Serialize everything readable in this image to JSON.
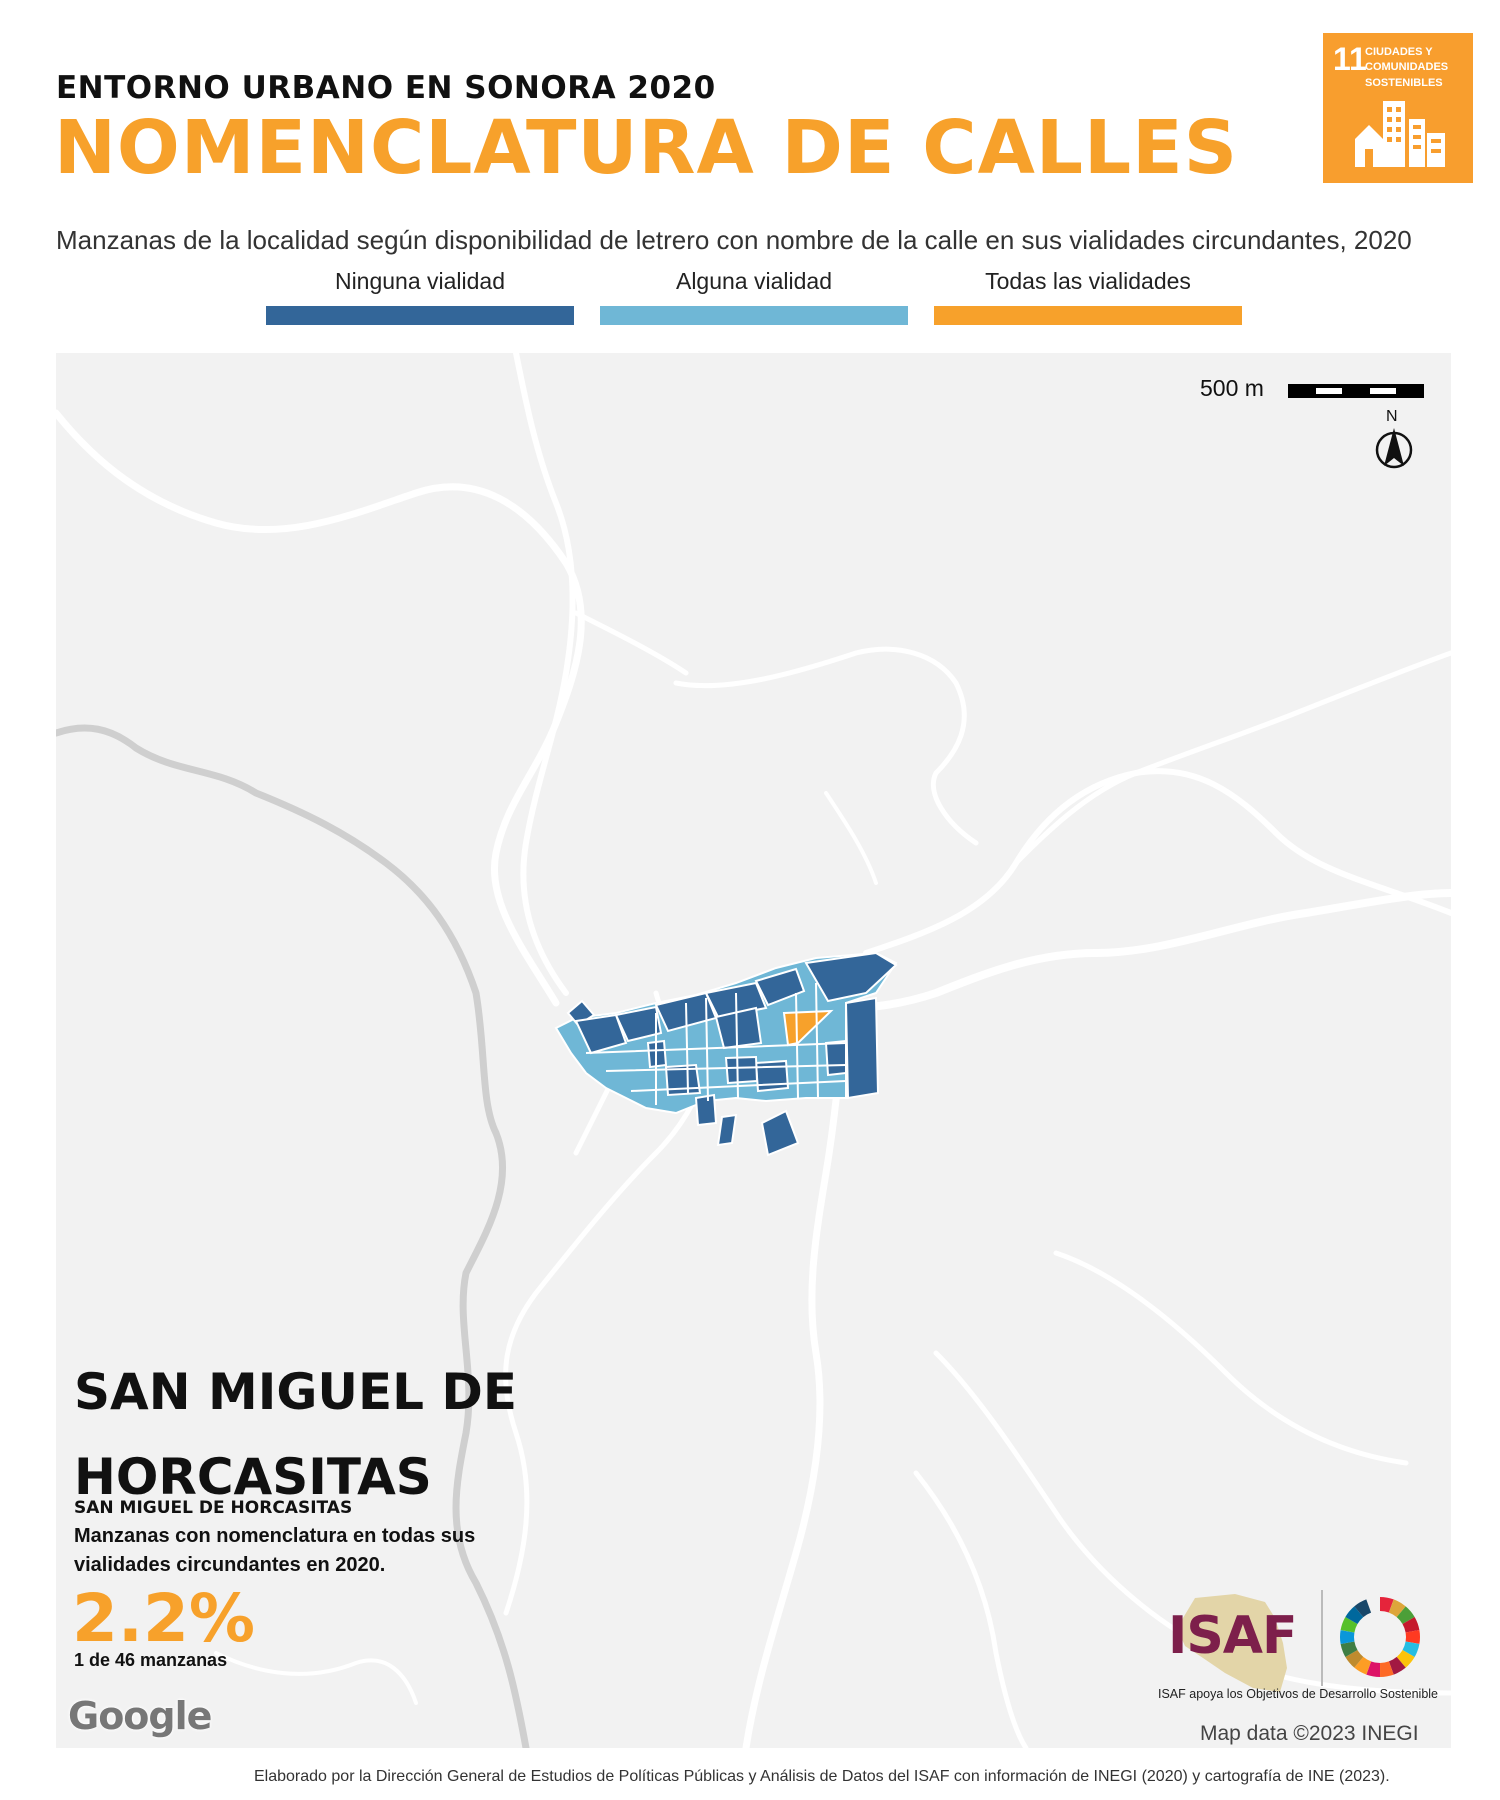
{
  "header": {
    "kicker": "ENTORNO URBANO EN SONORA 2020",
    "title": "NOMENCLATURA DE CALLES",
    "subtitle": "Manzanas de la localidad según disponibilidad de letrero con nombre de la calle en sus vialidades circundantes, 2020"
  },
  "legend": [
    {
      "label": "Ninguna vialidad",
      "color": "#336699"
    },
    {
      "label": "Alguna vialidad",
      "color": "#6fb7d6"
    },
    {
      "label": "Todas las vialidades",
      "color": "#f7a12b"
    }
  ],
  "sdg_badge": {
    "number": "11",
    "text": "CIUDADES Y\nCOMUNIDADES\nSOSTENIBLES",
    "color": "#f89e2e",
    "icon": "city-buildings-icon"
  },
  "map": {
    "scale_label": "500 m",
    "north_label": "N",
    "attribution": "Map data ©2023 INEGI",
    "provider_logo": "Google",
    "background_color": "#f2f2f2"
  },
  "place": {
    "name": "SAN MIGUEL DE HORCASITAS",
    "municipality": "SAN MIGUEL DE HORCASITAS",
    "description": "Manzanas con nomenclatura en todas sus vialidades circundantes en 2020.",
    "percentage": "2.2%",
    "count_text": "1 de 46 manzanas"
  },
  "logos": {
    "isaf": "ISAF",
    "isaf_caption": "ISAF apoya los Objetivos de Desarrollo Sostenible",
    "isaf_color": "#7d1f4b"
  },
  "footer": "Elaborado por la Dirección General de Estudios de Políticas Públicas y Análisis de Datos del ISAF con información de INEGI (2020) y cartografía de INE (2023)."
}
